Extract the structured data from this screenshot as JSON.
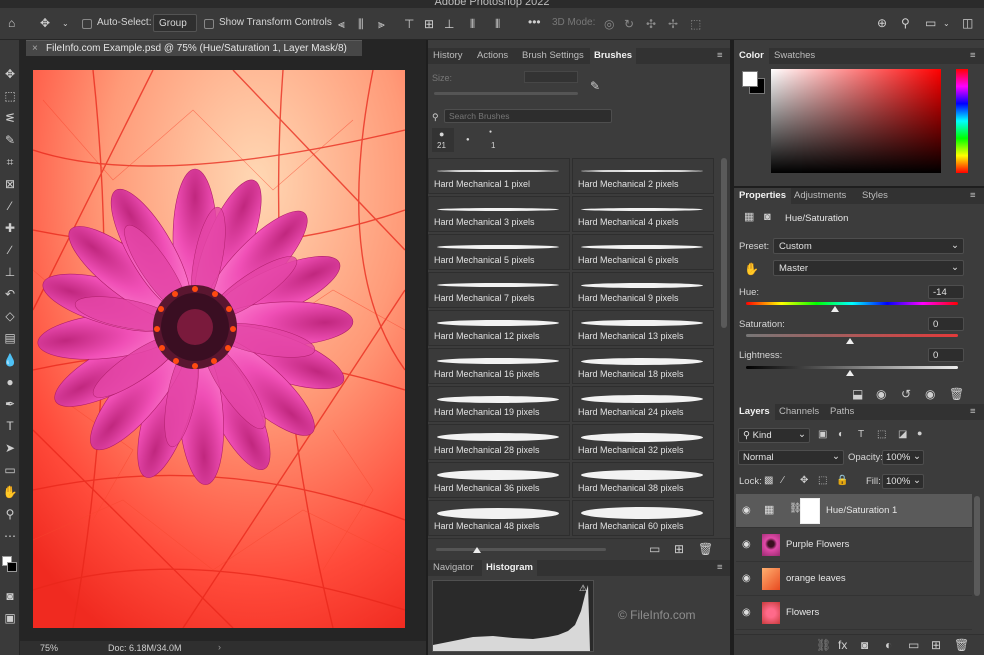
{
  "app": {
    "title": "Adobe Photoshop 2022"
  },
  "options_bar": {
    "auto_select_label": "Auto-Select:",
    "auto_select_value": "Group",
    "show_transform_label": "Show Transform Controls",
    "mode_3d_label": "3D Mode:"
  },
  "document": {
    "tab_title": "FileInfo.com Example.psd @ 75% (Hue/Saturation 1, Layer Mask/8)",
    "zoom": "75%",
    "doc_size": "Doc: 6.18M/34.0M"
  },
  "brush_panel": {
    "tabs": [
      "History",
      "Actions",
      "Brush Settings",
      "Brushes"
    ],
    "active_tab": "Brushes",
    "size_label": "Size:",
    "search_placeholder": "Search Brushes",
    "recent_brushes": [
      "21",
      "",
      "1"
    ],
    "brushes": [
      "Hard Mechanical 1 pixel",
      "Hard Mechanical 2 pixels",
      "Hard Mechanical 3 pixels",
      "Hard Mechanical 4 pixels",
      "Hard Mechanical 5 pixels",
      "Hard Mechanical 6 pixels",
      "Hard Mechanical 7 pixels",
      "Hard Mechanical 9 pixels",
      "Hard Mechanical 12 pixels",
      "Hard Mechanical 13 pixels",
      "Hard Mechanical 16 pixels",
      "Hard Mechanical 18 pixels",
      "Hard Mechanical 19 pixels",
      "Hard Mechanical 24 pixels",
      "Hard Mechanical 28 pixels",
      "Hard Mechanical 32 pixels",
      "Hard Mechanical 36 pixels",
      "Hard Mechanical 38 pixels",
      "Hard Mechanical 48 pixels",
      "Hard Mechanical 60 pixels"
    ]
  },
  "navigator_panel": {
    "tabs": [
      "Navigator",
      "Histogram"
    ],
    "active_tab": "Histogram",
    "watermark": "© FileInfo.com"
  },
  "color_panel": {
    "tabs": [
      "Color",
      "Swatches"
    ],
    "active_tab": "Color",
    "foreground": "#ffffff",
    "background": "#000000"
  },
  "properties_panel": {
    "tabs": [
      "Properties",
      "Adjustments",
      "Styles"
    ],
    "active_tab": "Properties",
    "adjustment_name": "Hue/Saturation",
    "preset_label": "Preset:",
    "preset_value": "Custom",
    "channel_value": "Master",
    "hue_label": "Hue:",
    "hue_value": "-14",
    "saturation_label": "Saturation:",
    "saturation_value": "0",
    "lightness_label": "Lightness:",
    "lightness_value": "0"
  },
  "layers_panel": {
    "tabs": [
      "Layers",
      "Channels",
      "Paths"
    ],
    "active_tab": "Layers",
    "filter_kind": "Kind",
    "blend_mode": "Normal",
    "opacity_label": "Opacity:",
    "opacity_value": "100%",
    "lock_label": "Lock:",
    "fill_label": "Fill:",
    "fill_value": "100%",
    "layers": [
      {
        "name": "Hue/Saturation 1",
        "selected": true
      },
      {
        "name": "Purple Flowers",
        "selected": false
      },
      {
        "name": "orange leaves",
        "selected": false
      },
      {
        "name": "Flowers",
        "selected": false
      }
    ]
  }
}
